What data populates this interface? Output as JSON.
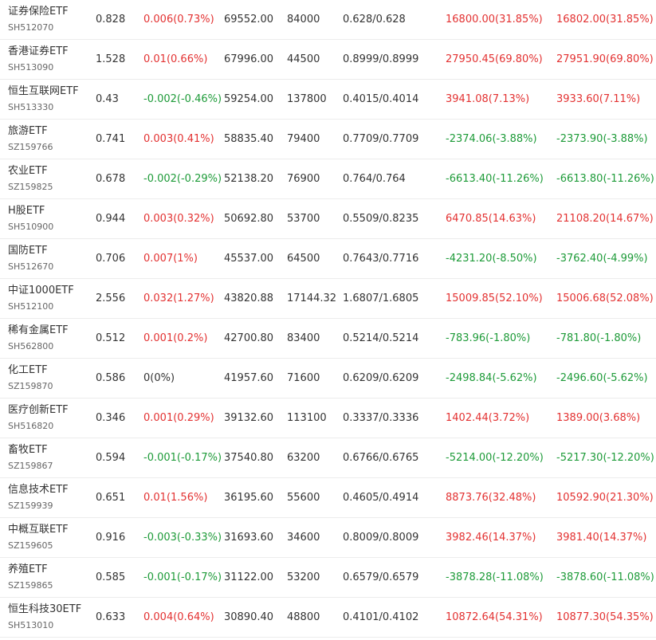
{
  "colors": {
    "up": "#e33232",
    "down": "#1e9b39",
    "neutral": "#333333"
  },
  "rows": [
    {
      "name": "证券保险ETF",
      "code": "SH512070",
      "price": "0.828",
      "change": "0.006(0.73%)",
      "change_dir": "up",
      "val1": "69552.00",
      "val2": "84000",
      "ratio": "0.628/0.628",
      "profit1": "16800.00(31.85%)",
      "profit1_dir": "up",
      "profit2": "16802.00(31.85%)",
      "profit2_dir": "up"
    },
    {
      "name": "香港证券ETF",
      "code": "SH513090",
      "price": "1.528",
      "change": "0.01(0.66%)",
      "change_dir": "up",
      "val1": "67996.00",
      "val2": "44500",
      "ratio": "0.8999/0.8999",
      "profit1": "27950.45(69.80%)",
      "profit1_dir": "up",
      "profit2": "27951.90(69.80%)",
      "profit2_dir": "up"
    },
    {
      "name": "恒生互联网ETF",
      "code": "SH513330",
      "price": "0.43",
      "change": "-0.002(-0.46%)",
      "change_dir": "down",
      "val1": "59254.00",
      "val2": "137800",
      "ratio": "0.4015/0.4014",
      "profit1": "3941.08(7.13%)",
      "profit1_dir": "up",
      "profit2": "3933.60(7.11%)",
      "profit2_dir": "up"
    },
    {
      "name": "旅游ETF",
      "code": "SZ159766",
      "price": "0.741",
      "change": "0.003(0.41%)",
      "change_dir": "up",
      "val1": "58835.40",
      "val2": "79400",
      "ratio": "0.7709/0.7709",
      "profit1": "-2374.06(-3.88%)",
      "profit1_dir": "down",
      "profit2": "-2373.90(-3.88%)",
      "profit2_dir": "down"
    },
    {
      "name": "农业ETF",
      "code": "SZ159825",
      "price": "0.678",
      "change": "-0.002(-0.29%)",
      "change_dir": "down",
      "val1": "52138.20",
      "val2": "76900",
      "ratio": "0.764/0.764",
      "profit1": "-6613.40(-11.26%)",
      "profit1_dir": "down",
      "profit2": "-6613.80(-11.26%)",
      "profit2_dir": "down"
    },
    {
      "name": "H股ETF",
      "code": "SH510900",
      "price": "0.944",
      "change": "0.003(0.32%)",
      "change_dir": "up",
      "val1": "50692.80",
      "val2": "53700",
      "ratio": "0.5509/0.8235",
      "profit1": "6470.85(14.63%)",
      "profit1_dir": "up",
      "profit2": "21108.20(14.67%)",
      "profit2_dir": "up"
    },
    {
      "name": "国防ETF",
      "code": "SH512670",
      "price": "0.706",
      "change": "0.007(1%)",
      "change_dir": "up",
      "val1": "45537.00",
      "val2": "64500",
      "ratio": "0.7643/0.7716",
      "profit1": "-4231.20(-8.50%)",
      "profit1_dir": "down",
      "profit2": "-3762.40(-4.99%)",
      "profit2_dir": "down"
    },
    {
      "name": "中证1000ETF",
      "code": "SH512100",
      "price": "2.556",
      "change": "0.032(1.27%)",
      "change_dir": "up",
      "val1": "43820.88",
      "val2": "17144.32",
      "ratio": "1.6807/1.6805",
      "profit1": "15009.85(52.10%)",
      "profit1_dir": "up",
      "profit2": "15006.68(52.08%)",
      "profit2_dir": "up"
    },
    {
      "name": "稀有金属ETF",
      "code": "SH562800",
      "price": "0.512",
      "change": "0.001(0.2%)",
      "change_dir": "up",
      "val1": "42700.80",
      "val2": "83400",
      "ratio": "0.5214/0.5214",
      "profit1": "-783.96(-1.80%)",
      "profit1_dir": "down",
      "profit2": "-781.80(-1.80%)",
      "profit2_dir": "down"
    },
    {
      "name": "化工ETF",
      "code": "SZ159870",
      "price": "0.586",
      "change": "0(0%)",
      "change_dir": "neutral",
      "val1": "41957.60",
      "val2": "71600",
      "ratio": "0.6209/0.6209",
      "profit1": "-2498.84(-5.62%)",
      "profit1_dir": "down",
      "profit2": "-2496.60(-5.62%)",
      "profit2_dir": "down"
    },
    {
      "name": "医疗创新ETF",
      "code": "SH516820",
      "price": "0.346",
      "change": "0.001(0.29%)",
      "change_dir": "up",
      "val1": "39132.60",
      "val2": "113100",
      "ratio": "0.3337/0.3336",
      "profit1": "1402.44(3.72%)",
      "profit1_dir": "up",
      "profit2": "1389.00(3.68%)",
      "profit2_dir": "up"
    },
    {
      "name": "畜牧ETF",
      "code": "SZ159867",
      "price": "0.594",
      "change": "-0.001(-0.17%)",
      "change_dir": "down",
      "val1": "37540.80",
      "val2": "63200",
      "ratio": "0.6766/0.6765",
      "profit1": "-5214.00(-12.20%)",
      "profit1_dir": "down",
      "profit2": "-5217.30(-12.20%)",
      "profit2_dir": "down"
    },
    {
      "name": "信息技术ETF",
      "code": "SZ159939",
      "price": "0.651",
      "change": "0.01(1.56%)",
      "change_dir": "up",
      "val1": "36195.60",
      "val2": "55600",
      "ratio": "0.4605/0.4914",
      "profit1": "8873.76(32.48%)",
      "profit1_dir": "up",
      "profit2": "10592.90(21.30%)",
      "profit2_dir": "up"
    },
    {
      "name": "中概互联ETF",
      "code": "SZ159605",
      "price": "0.916",
      "change": "-0.003(-0.33%)",
      "change_dir": "down",
      "val1": "31693.60",
      "val2": "34600",
      "ratio": "0.8009/0.8009",
      "profit1": "3982.46(14.37%)",
      "profit1_dir": "up",
      "profit2": "3981.40(14.37%)",
      "profit2_dir": "up"
    },
    {
      "name": "养殖ETF",
      "code": "SZ159865",
      "price": "0.585",
      "change": "-0.001(-0.17%)",
      "change_dir": "down",
      "val1": "31122.00",
      "val2": "53200",
      "ratio": "0.6579/0.6579",
      "profit1": "-3878.28(-11.08%)",
      "profit1_dir": "down",
      "profit2": "-3878.60(-11.08%)",
      "profit2_dir": "down"
    },
    {
      "name": "恒生科技30ETF",
      "code": "SH513010",
      "price": "0.633",
      "change": "0.004(0.64%)",
      "change_dir": "up",
      "val1": "30890.40",
      "val2": "48800",
      "ratio": "0.4101/0.4102",
      "profit1": "10872.64(54.31%)",
      "profit1_dir": "up",
      "profit2": "10877.30(54.35%)",
      "profit2_dir": "up"
    }
  ]
}
